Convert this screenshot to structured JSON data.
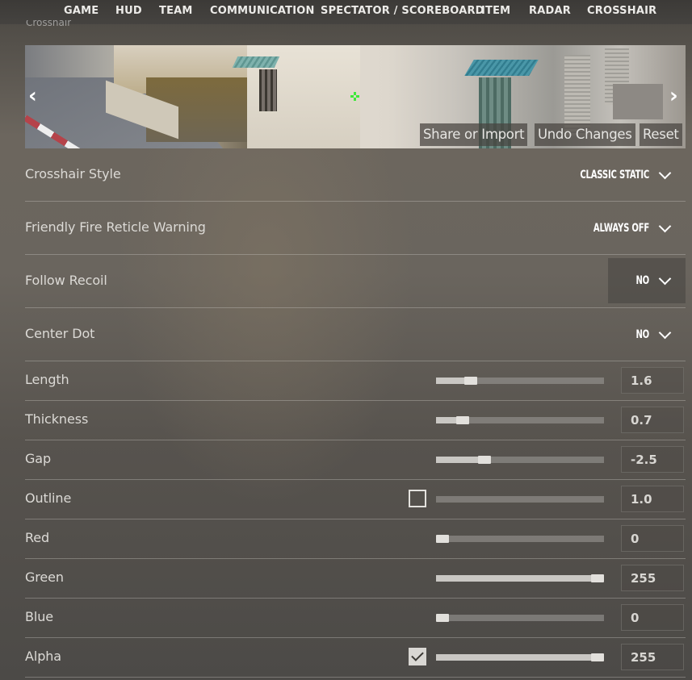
{
  "nav": {
    "tabs": [
      {
        "label": "GAME"
      },
      {
        "label": "HUD"
      },
      {
        "label": "TEAM"
      },
      {
        "label": "COMMUNICATION"
      },
      {
        "label": "SPECTATOR / SCOREBOARD"
      },
      {
        "label": "ITEM"
      },
      {
        "label": "RADAR"
      },
      {
        "label": "CROSSHAIR"
      }
    ]
  },
  "section": {
    "heading": "Crosshair"
  },
  "preview": {
    "prev_icon": "chevron-left-icon",
    "next_icon": "chevron-right-icon",
    "prev_glyph": "‹",
    "next_glyph": "›",
    "crosshair_color": "#3ee83a",
    "buttons": {
      "share": "Share or Import",
      "undo": "Undo Changes",
      "reset": "Reset"
    }
  },
  "dropdowns": [
    {
      "label": "Crosshair Style",
      "value": "CLASSIC STATIC"
    },
    {
      "label": "Friendly Fire Reticle Warning",
      "value": "ALWAYS OFF"
    },
    {
      "label": "Follow Recoil",
      "value": "NO"
    },
    {
      "label": "Center Dot",
      "value": "NO"
    }
  ],
  "sliders": [
    {
      "label": "Length",
      "value": "1.6",
      "fraction": 0.18
    },
    {
      "label": "Thickness",
      "value": "0.7",
      "fraction": 0.13
    },
    {
      "label": "Gap",
      "value": "-2.5",
      "fraction": 0.27
    },
    {
      "label": "Outline",
      "value": "1.0",
      "fraction": null,
      "checkbox": false
    },
    {
      "label": "Red",
      "value": "0",
      "fraction": 0.0
    },
    {
      "label": "Green",
      "value": "255",
      "fraction": 1.0
    },
    {
      "label": "Blue",
      "value": "0",
      "fraction": 0.0
    },
    {
      "label": "Alpha",
      "value": "255",
      "fraction": 1.0,
      "checkbox": true
    }
  ]
}
